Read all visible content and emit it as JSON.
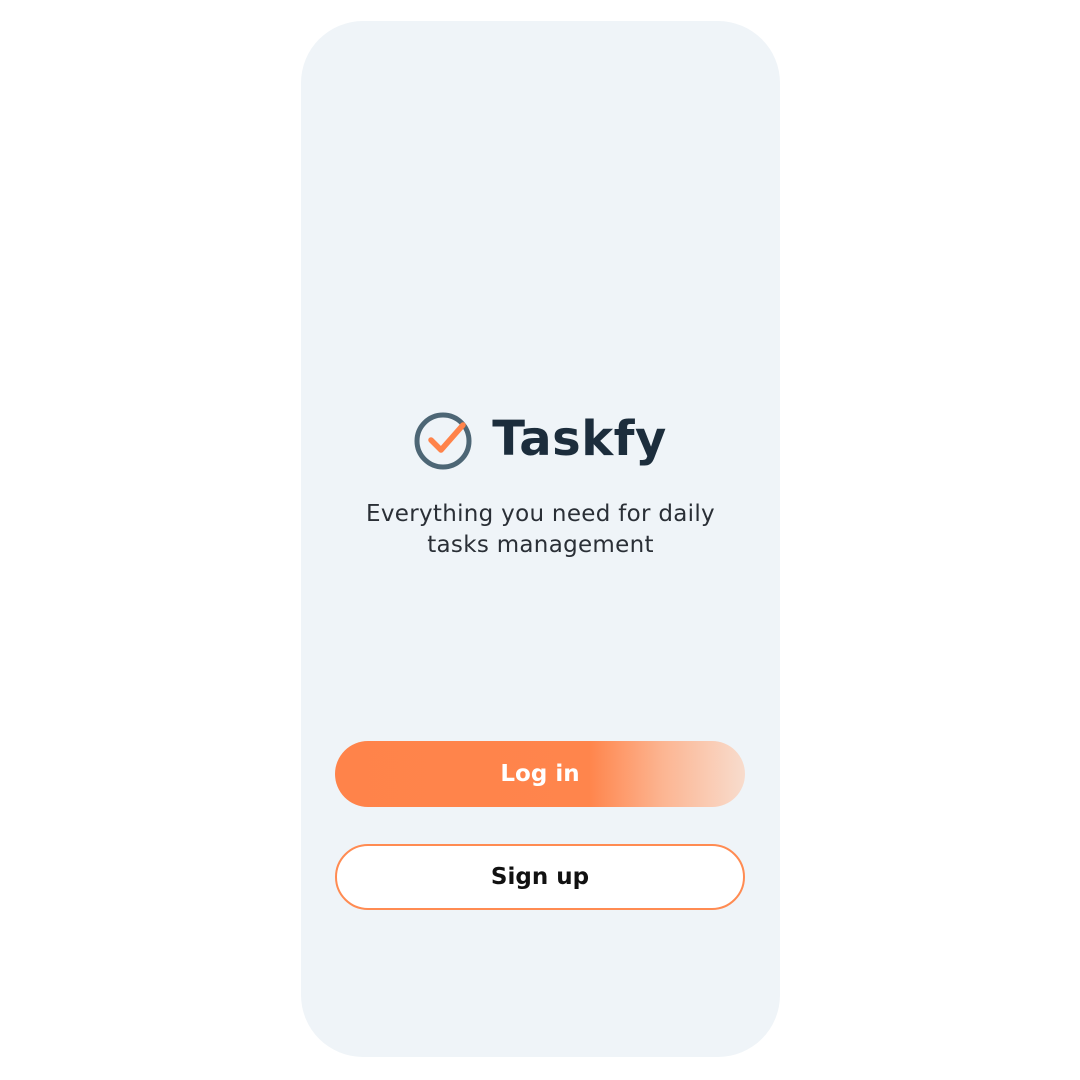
{
  "app": {
    "name": "Taskfy",
    "tagline_line1": "Everything you need for daily",
    "tagline_line2": "tasks management",
    "logo_icon": "check-circle-icon"
  },
  "actions": {
    "login_label": "Log in",
    "signup_label": "Sign up"
  },
  "colors": {
    "accent": "#ff834a",
    "brand_text": "#1c2d3c",
    "logo_ring": "#4d6675",
    "screen_background": "#eff4f8"
  }
}
